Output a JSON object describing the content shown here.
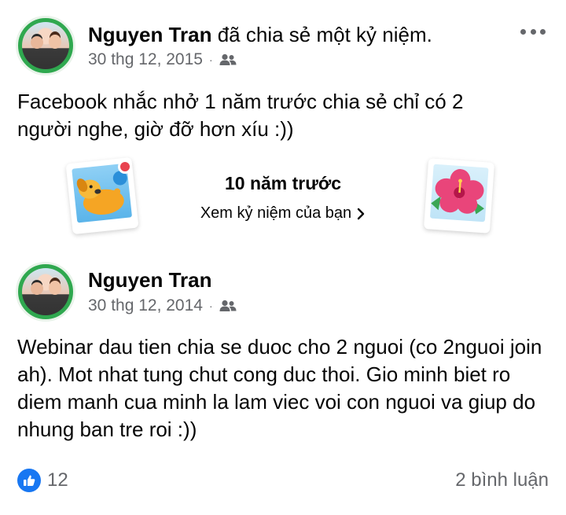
{
  "shared_post": {
    "author": "Nguyen Tran",
    "action": "đã chia sẻ một kỷ niệm.",
    "date": "30 thg 12, 2015",
    "dot": "·",
    "audience_icon": "friends-icon",
    "more_icon": "more-icon",
    "text": "Facebook nhắc nhở 1 năm trước chia sẻ chỉ có 2 người nghe, giờ đỡ hơn xíu :))"
  },
  "memory": {
    "title": "10 năm trước",
    "link_label": "Xem kỷ niệm của bạn",
    "link_icon": "chevron-right-icon",
    "left_illustration": "dog-photo-icon",
    "right_illustration": "hibiscus-photo-icon"
  },
  "original_post": {
    "author": "Nguyen Tran",
    "date": "30 thg 12, 2014",
    "dot": "·",
    "audience_icon": "friends-icon",
    "text": "Webinar dau tien chia se duoc cho 2 nguoi (co 2nguoi join ah). Mot nhat tung chut cong duc thoi. Gio minh biet ro diem manh cua minh la lam viec voi con nguoi va giup do nhung ban tre roi :))"
  },
  "footer": {
    "reaction_icon": "like-icon",
    "like_count": "12",
    "comments": "2 bình luận"
  },
  "colors": {
    "text": "#050505",
    "secondary": "#65676b",
    "accent": "#1877f2",
    "avatar_ring": "#2fa84f",
    "notif": "#e8434f"
  }
}
